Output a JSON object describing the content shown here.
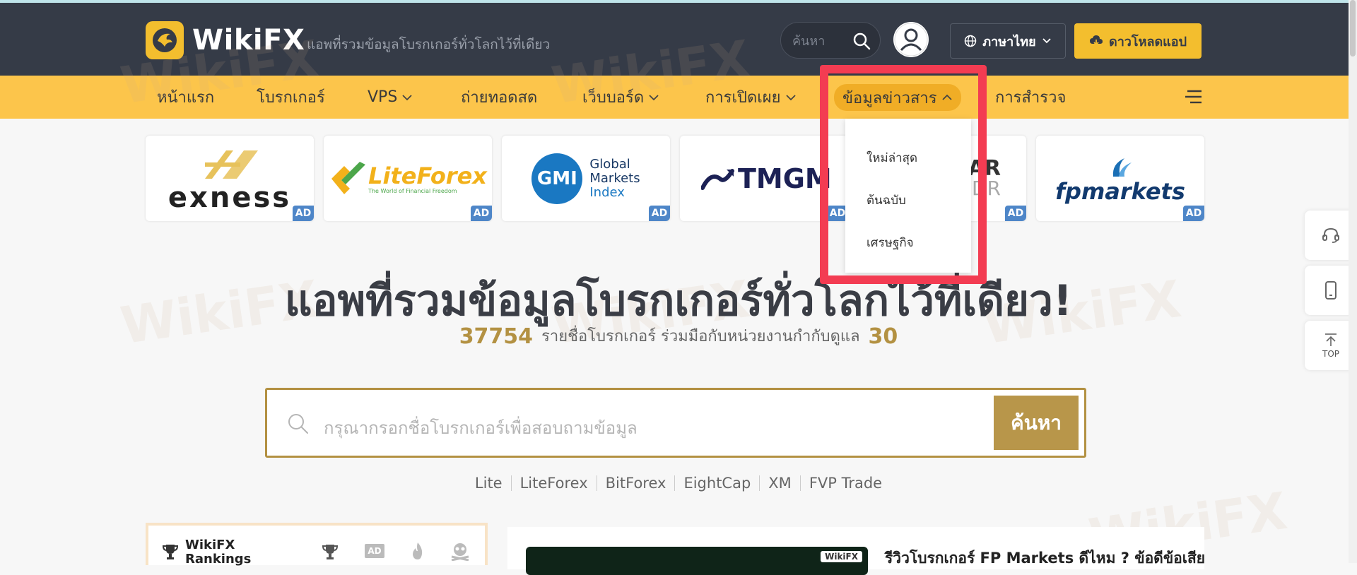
{
  "colors": {
    "header_bg": "#353b47",
    "nav_bg": "#fcc54b",
    "accent_gold": "#b39142",
    "download_btn": "#f3be2e",
    "ad_badge": "#4e86c8",
    "highlight_box": "#f33c52"
  },
  "header": {
    "logo_text": "WikiFX",
    "tagline": "แอพที่รวมข้อมูลโบรกเกอร์ทั่วโลกไว้ที่เดียว",
    "search_placeholder": "ค้นหา",
    "language_label": "ภาษาไทย",
    "download_label": "ดาวโหลดแอป"
  },
  "nav": {
    "items": [
      {
        "label": "หน้าแรก"
      },
      {
        "label": "โบรกเกอร์"
      },
      {
        "label": "VPS"
      },
      {
        "label": "ถ่ายทอดสด"
      },
      {
        "label": "เว็บบอร์ด"
      },
      {
        "label": "การเปิดเผย"
      },
      {
        "label": "ข้อมูลข่าวสาร"
      },
      {
        "label": "การสำรวจ"
      }
    ]
  },
  "dropdown": {
    "items": [
      {
        "label": "ใหม่ล่าสุด"
      },
      {
        "label": "ต้นฉบับ"
      },
      {
        "label": "เศรษฐกิจ"
      }
    ]
  },
  "ads": {
    "badge": "AD",
    "brands": [
      "exness",
      "LiteForex",
      "The World of Financial Freedom",
      "GMI",
      "Global",
      "Markets",
      "Index",
      "TMGM",
      "AR",
      "DR",
      "fpmarkets"
    ]
  },
  "hero": {
    "title": "แอพที่รวมข้อมูลโบรกเกอร์ทั่วโลกไว้ที่เดียว!",
    "broker_count": "37754",
    "subtitle_text": "รายชื่อโบรกเกอร์ ร่วมมือกับหน่วยงานกำกับดูแล",
    "regulator_count": "30"
  },
  "main_search": {
    "placeholder": "กรุณากรอกชื่อโบรกเกอร์เพื่อสอบถามข้อมูล",
    "button_label": "ค้นหา"
  },
  "quick_links": [
    "Lite",
    "LiteForex",
    "BitForex",
    "EightCap",
    "XM",
    "FVP Trade"
  ],
  "rankings": {
    "title_line1": "WikiFX",
    "title_line2": "Rankings",
    "ad_label": "AD"
  },
  "news": {
    "title": "รีวิวโบรกเกอร์ FP Markets ดีไหม ? ข้อดีข้อเสีย",
    "image_label": "WikiFX"
  },
  "side_tools": {
    "top_label": "TOP"
  },
  "watermark_text": "WikiFX"
}
